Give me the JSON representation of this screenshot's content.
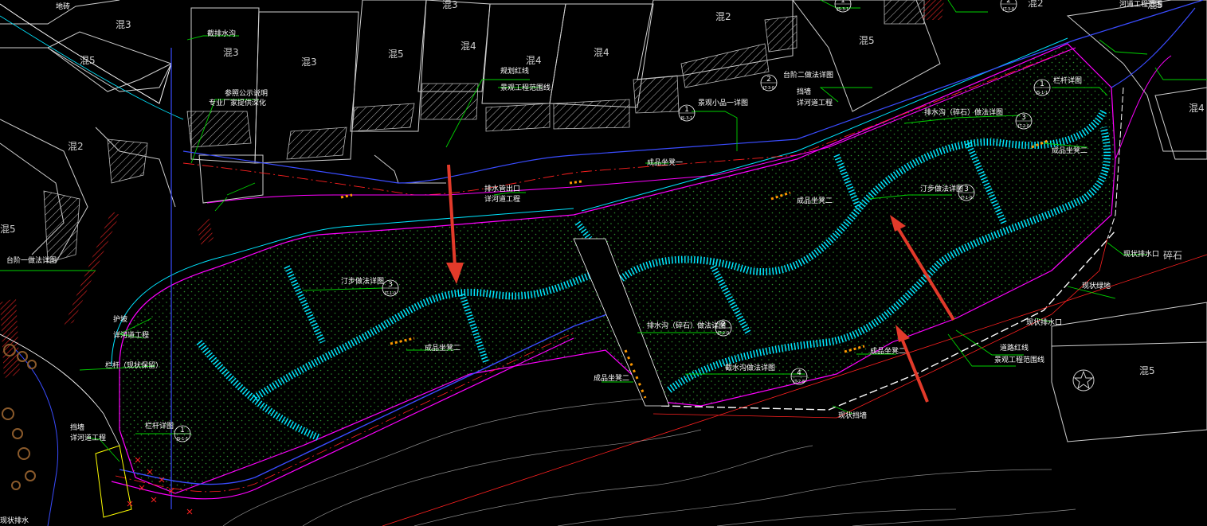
{
  "colors": {
    "background": "#000000",
    "leader": "#00d200",
    "path_outline": "#00e5ff",
    "planting_dots": "#2b8f2b",
    "redline": "#ff2020",
    "road_edge": "#ff00ff",
    "annotation_arrow": "#e23a2a",
    "building": "#cfcfcf"
  },
  "zones": [
    "混3",
    "混5",
    "混3",
    "混3",
    "混5",
    "混4",
    "混4",
    "混4",
    "混2",
    "混5",
    "混2",
    "混5",
    "混2",
    "混5",
    "混4",
    "混5",
    "碎石",
    "混3"
  ],
  "labels": {
    "top_left_edge": "地砖",
    "drain_ditch_a": "截排水沟",
    "project_note_a": "参照公示说明",
    "pro_line_a": "专业厂家提供深化",
    "boundary_line": "规划红线",
    "existing_topo": "景观工程范围线",
    "small_product_1": "景观小品一详图",
    "step_detail_2": "台阶二做法详图",
    "retaining_wall": "挡墙",
    "see_river_work": "详河道工程",
    "railing_detail_top": "栏杆详图",
    "drain_gravel_top": "排水沟（碎石）做法详图",
    "river_work_right": "河道工程范围",
    "bench_product_1": "成品坐凳一",
    "bench_product_2a": "成品坐凳二",
    "stepping_detail_right": "汀步做法详图",
    "drain_pipe_out": "排水管出口",
    "see_river_mid": "详河道工程",
    "step_detail_1": "台阶一做法详图",
    "stepping_detail_left": "汀步做法详图",
    "bench_product_2b": "成品坐凳二",
    "drain_gravel_mid": "排水沟（碎石）做法详图",
    "bench_product_2c": "成品坐凳二",
    "drain_gravel_low": "截水沟做法详图",
    "bench_product_2d": "成品坐凳二",
    "fence_1": "护坡",
    "see_river_left": "详河道工程",
    "railing_existing": "栏杆（现状保留）",
    "railing_detail_bottom": "栏杆详图",
    "retaining_bottom": "挡墙",
    "see_river_bottom": "详河道工程",
    "drain_inlet": "现状排水口",
    "road_redline": "道路红线",
    "landscape_line": "景观工程范围线",
    "crossing": "现状排水口",
    "edge_lawn": "现状绿地",
    "wall_below": "现状挡墙",
    "bottom_left": "现状排水"
  },
  "callouts": [
    {
      "num": "1",
      "sub": "JS-3-1"
    },
    {
      "num": "2",
      "sub": "JT-3-0"
    },
    {
      "num": "1",
      "sub": "JS-1-1"
    },
    {
      "num": "3",
      "sub": "JT-2-0"
    },
    {
      "num": "3",
      "sub": "JT-1-0"
    },
    {
      "num": "3",
      "sub": "JT-1-0"
    },
    {
      "num": "2",
      "sub": "JT-2-0"
    },
    {
      "num": "4",
      "sub": "JT-2-8"
    },
    {
      "num": "1",
      "sub": "JS-1-1"
    },
    {
      "num": "2",
      "sub": "JT-3-0"
    },
    {
      "num": "1",
      "sub": "JS-3-1"
    }
  ]
}
